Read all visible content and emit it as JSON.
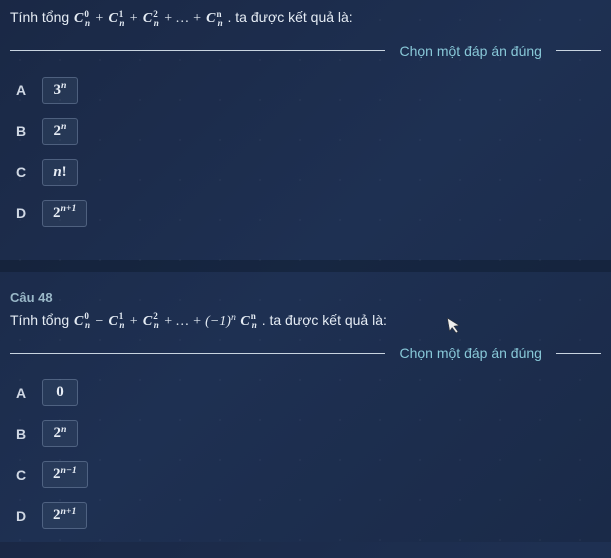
{
  "q1": {
    "prompt_prefix": "Tính tổng ",
    "formula_html": "<span class='combo'>C<span class='sup'>0</span><span class='sub'>n</span></span> + <span class='combo'>C<span class='sup'>1</span><span class='sub'>n</span></span> + <span class='combo'>C<span class='sup'>2</span><span class='sub'>n</span></span> + … + <span class='combo'>C<span class='sup'>n</span><span class='sub'>n</span></span>",
    "prompt_suffix": ". ta được kết quả là:",
    "instruction": "Chọn một đáp án đúng",
    "options": [
      {
        "letter": "A",
        "value_html": "3<span class='exp'>n</span>"
      },
      {
        "letter": "B",
        "value_html": "2<span class='exp'>n</span>"
      },
      {
        "letter": "C",
        "value_html": "<span style='font-style:italic'>n</span>!"
      },
      {
        "letter": "D",
        "value_html": "2<span class='exp'>n+1</span>"
      }
    ]
  },
  "q2": {
    "label": "Câu 48",
    "prompt_prefix": "Tính tổng ",
    "formula_html": "<span class='combo'>C<span class='sup'>0</span><span class='sub'>n</span></span> − <span class='combo'>C<span class='sup'>1</span><span class='sub'>n</span></span> + <span class='combo'>C<span class='sup'>2</span><span class='sub'>n</span></span> + … + (−1)<span class='exp' style='font-size:0.7em;position:relative;top:-0.5em;font-style:italic'>n</span> <span class='combo'>C<span class='sup'>n</span><span class='sub'>n</span></span>",
    "prompt_suffix": ". ta được kết quả là:",
    "instruction": "Chọn một đáp án đúng",
    "options": [
      {
        "letter": "A",
        "value_html": "0"
      },
      {
        "letter": "B",
        "value_html": "2<span class='exp'>n</span>"
      },
      {
        "letter": "C",
        "value_html": "2<span class='exp'>n−1</span>"
      },
      {
        "letter": "D",
        "value_html": "2<span class='exp'>n+1</span>"
      }
    ]
  }
}
